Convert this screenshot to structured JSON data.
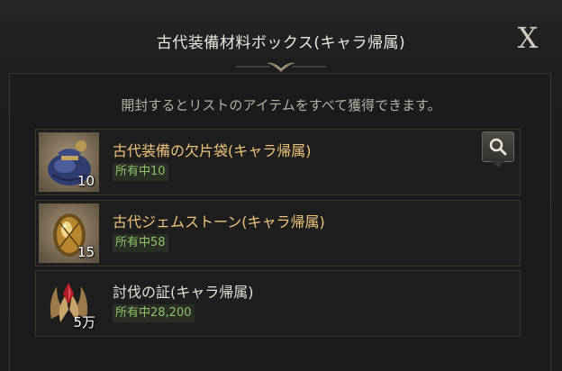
{
  "dialog": {
    "title": "古代装備材料ボックス(キャラ帰属)",
    "close_label": "X",
    "description": "開封するとリストのアイテムをすべて獲得できます。"
  },
  "items": [
    {
      "name": "古代装備の欠片袋(キャラ帰属)",
      "quantity": "10",
      "owned": "所有中10",
      "icon": "pouch-icon",
      "name_color": "#f0c47a"
    },
    {
      "name": "古代ジェムストーン(キャラ帰属)",
      "quantity": "15",
      "owned": "所有中58",
      "icon": "gemstone-icon",
      "name_color": "#f0c47a"
    },
    {
      "name": "討伐の証(キャラ帰属)",
      "quantity": "5万",
      "owned": "所有中28,200",
      "icon": "crest-icon",
      "name_color": "#e4e0d8"
    }
  ],
  "icons": {
    "search": "magnifier-icon",
    "close": "close-icon"
  }
}
